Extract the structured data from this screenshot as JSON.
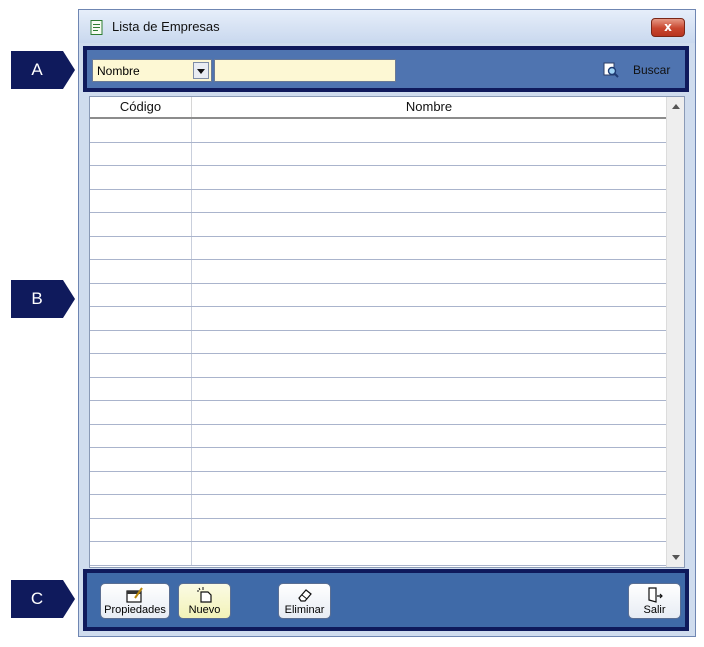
{
  "callouts": {
    "a": "A",
    "b": "B",
    "c": "C"
  },
  "window": {
    "title": "Lista de Empresas",
    "close": "x"
  },
  "filter": {
    "field_value": "Nombre",
    "search_value": "",
    "search_label": "Buscar"
  },
  "grid": {
    "columns": [
      "Código",
      "Nombre"
    ],
    "rows": [
      [
        "",
        ""
      ],
      [
        "",
        ""
      ],
      [
        "",
        ""
      ],
      [
        "",
        ""
      ],
      [
        "",
        ""
      ],
      [
        "",
        ""
      ],
      [
        "",
        ""
      ],
      [
        "",
        ""
      ],
      [
        "",
        ""
      ],
      [
        "",
        ""
      ],
      [
        "",
        ""
      ],
      [
        "",
        ""
      ],
      [
        "",
        ""
      ],
      [
        "",
        ""
      ],
      [
        "",
        ""
      ],
      [
        "",
        ""
      ],
      [
        "",
        ""
      ],
      [
        "",
        ""
      ],
      [
        "",
        ""
      ]
    ]
  },
  "actions": {
    "properties": "Propiedades",
    "new": "Nuevo",
    "delete": "Eliminar",
    "exit": "Salir"
  },
  "colors": {
    "callout": "#0f1a5c",
    "toolbar": "#4f74b0",
    "input_bg": "#fdf8d4",
    "close": "#c8462e"
  }
}
